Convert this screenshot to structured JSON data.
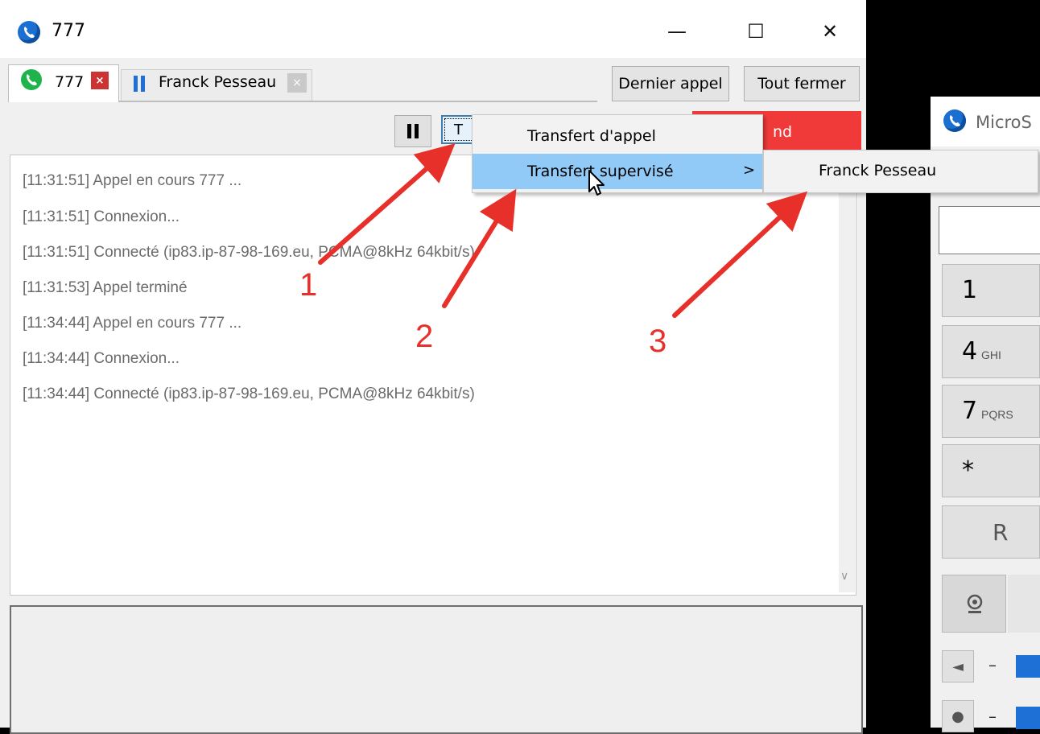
{
  "window": {
    "title": "777",
    "controls": {
      "minimize": "—",
      "maximize": "☐",
      "close": "✕"
    }
  },
  "tabs": [
    {
      "label": "777",
      "close": "×",
      "status_icon": "phone-icon"
    },
    {
      "label": "Franck Pesseau",
      "close": "×",
      "status_icon": "pause-icon"
    }
  ],
  "tab_buttons": {
    "last_call": "Dernier appel",
    "close_all": "Tout fermer"
  },
  "toolbar": {
    "transfer_label": "T",
    "end_label": "nd"
  },
  "log": [
    "[11:31:51]  Appel en cours 777 ...",
    "[11:31:51]  Connexion...",
    "[11:31:51]  Connecté (ip83.ip-87-98-169.eu, PCMA@8kHz 64kbit/s)",
    "[11:31:53]  Appel terminé",
    "[11:34:44]  Appel en cours 777 ...",
    "[11:34:44]  Connexion...",
    "[11:34:44]  Connecté (ip83.ip-87-98-169.eu, PCMA@8kHz 64kbit/s)"
  ],
  "context_menu": {
    "items": [
      "Transfert d'appel",
      "Transfert supervisé"
    ],
    "submenu_arrow": ">",
    "submenu_items": [
      "Franck Pesseau"
    ]
  },
  "second_window": {
    "title": "MicroS",
    "keys": [
      {
        "num": "1",
        "sub": ""
      },
      {
        "num": "4",
        "sub": "GHI"
      },
      {
        "num": "7",
        "sub": "PQRS"
      },
      {
        "num": "*",
        "sub": ""
      },
      {
        "num": "R",
        "sub": ""
      }
    ],
    "dash": "–"
  },
  "annotations": [
    "1",
    "2",
    "3"
  ],
  "colors": {
    "accent_red": "#e8302a",
    "menu_highlight": "#91c9f7",
    "end_button": "#f03a3a"
  }
}
